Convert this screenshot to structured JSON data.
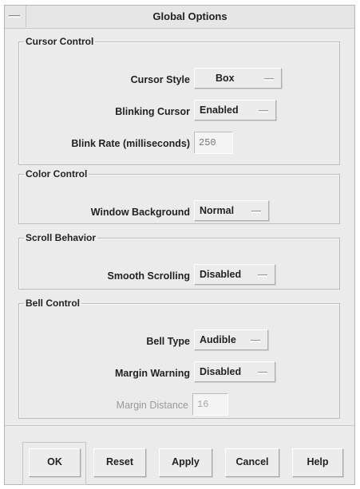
{
  "window": {
    "title": "Global Options"
  },
  "cursor_control": {
    "legend": "Cursor Control",
    "cursor_style_label": "Cursor Style",
    "cursor_style_value": "Box",
    "blinking_cursor_label": "Blinking Cursor",
    "blinking_cursor_value": "Enabled",
    "blink_rate_label": "Blink Rate (milliseconds)",
    "blink_rate_value": "250"
  },
  "color_control": {
    "legend": "Color Control",
    "window_background_label": "Window Background",
    "window_background_value": "Normal"
  },
  "scroll_behavior": {
    "legend": "Scroll Behavior",
    "smooth_scrolling_label": "Smooth Scrolling",
    "smooth_scrolling_value": "Disabled"
  },
  "bell_control": {
    "legend": "Bell Control",
    "bell_type_label": "Bell Type",
    "bell_type_value": "Audible",
    "margin_warning_label": "Margin Warning",
    "margin_warning_value": "Disabled",
    "margin_distance_label": "Margin Distance",
    "margin_distance_value": "16"
  },
  "buttons": {
    "ok": "OK",
    "reset": "Reset",
    "apply": "Apply",
    "cancel": "Cancel",
    "help": "Help"
  }
}
